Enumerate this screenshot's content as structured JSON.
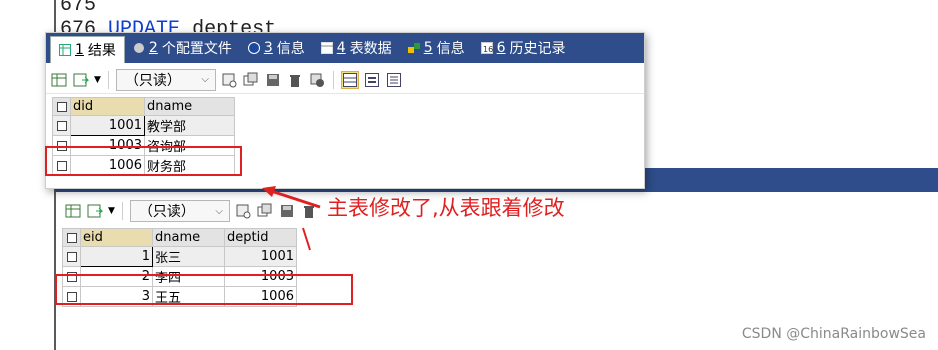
{
  "editor": {
    "line1": "675",
    "line2_num": "676",
    "line2_kw": "UPDATE",
    "line2_rest": "deptest"
  },
  "top_panel": {
    "tabs": [
      {
        "num": "1",
        "label": "结果",
        "icon": "grid-icon"
      },
      {
        "num": "2",
        "label": "个配置文件",
        "icon": "profile-icon"
      },
      {
        "num": "3",
        "label": "信息",
        "icon": "info-icon"
      },
      {
        "num": "4",
        "label": "表数据",
        "icon": "table-icon"
      },
      {
        "num": "5",
        "label": "信息",
        "icon": "info-color-icon"
      },
      {
        "num": "6",
        "label": "历史记录",
        "icon": "history-icon"
      }
    ],
    "mode": "（只读）",
    "columns": [
      "did",
      "dname"
    ],
    "rows": [
      {
        "did": "1001",
        "dname": "教学部"
      },
      {
        "did": "1003",
        "dname": "咨询部"
      },
      {
        "did": "1006",
        "dname": "财务部"
      }
    ]
  },
  "bottom_panel": {
    "mode": "（只读）",
    "columns": [
      "eid",
      "dname",
      "deptid"
    ],
    "rows": [
      {
        "eid": "1",
        "dname": "张三",
        "deptid": "1001"
      },
      {
        "eid": "2",
        "dname": "李四",
        "deptid": "1003"
      },
      {
        "eid": "3",
        "dname": "王五",
        "deptid": "1006"
      }
    ]
  },
  "annotation": "主表修改了,从表跟着修改",
  "watermark": "CSDN @ChinaRainbowSea",
  "colors": {
    "tab_bar": "#2e4d8a",
    "annotation_red": "#e02020"
  }
}
